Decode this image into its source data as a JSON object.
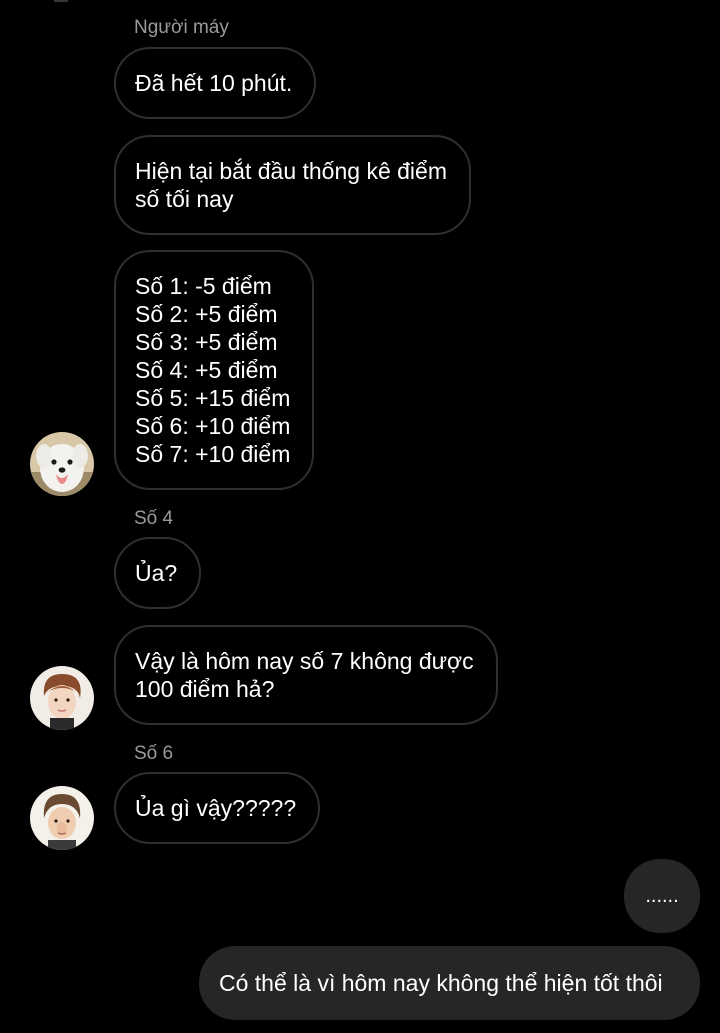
{
  "chat": {
    "group1": {
      "sender": "Người máy",
      "messages": [
        {
          "lines": [
            "Đã hết 10 phút."
          ]
        },
        {
          "lines": [
            "Hiện tại bắt đầu thống kê điểm",
            "số tối nay"
          ]
        },
        {
          "lines": [
            "Số 1: -5 điểm",
            "Số 2: +5 điểm",
            "Số 3: +5 điểm",
            "Số 4: +5 điểm",
            "Số 5: +15 điểm",
            "Số 6: +10 điểm",
            "Số 7: +10 điểm"
          ]
        }
      ]
    },
    "group2": {
      "sender": "Số 4",
      "messages": [
        {
          "lines": [
            "Ủa?"
          ]
        },
        {
          "lines": [
            "Vậy là hôm nay số 7 không được",
            "100 điểm hả?"
          ]
        }
      ]
    },
    "group3": {
      "sender": "Số 6",
      "messages": [
        {
          "lines": [
            "Ủa gì vậy?????"
          ]
        }
      ]
    },
    "outgoing": [
      {
        "text": "......"
      },
      {
        "text": "Có thể là vì hôm nay không thể hiện tốt thôi"
      }
    ]
  },
  "colors": {
    "background": "#000000",
    "incoming_border": "#2f2f2f",
    "outgoing_bubble": "#262626",
    "sender_label": "#9a9a9a"
  }
}
